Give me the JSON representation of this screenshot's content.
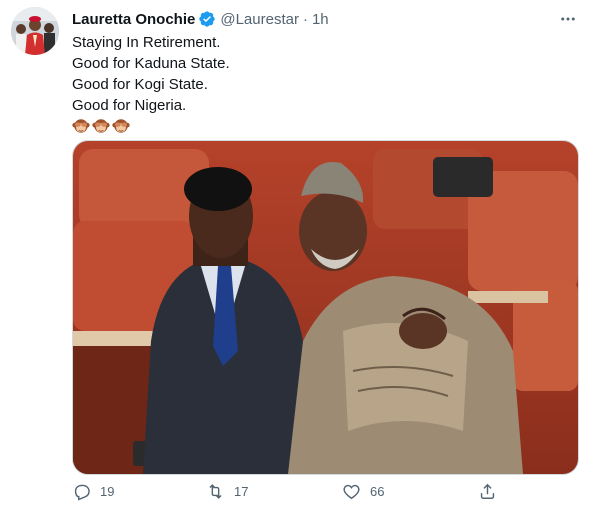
{
  "tweet": {
    "author_name": "Lauretta Onochie",
    "handle": "@Laurestar",
    "separator": "·",
    "time": "1h",
    "lines": [
      "Staying In Retirement.",
      "Good for Kaduna State.",
      "Good for Kogi State.",
      "Good for Nigeria."
    ],
    "emojis": [
      "see-no-evil-monkey",
      "see-no-evil-monkey",
      "see-no-evil-monkey"
    ]
  },
  "actions": {
    "replies": "19",
    "retweets": "17",
    "likes": "66"
  },
  "colors": {
    "verified_badge": "#1d9bf0",
    "secondary_text": "#536471",
    "border": "#cfd9de"
  },
  "icons": {
    "verified": "verified-badge-icon",
    "more": "more-options-icon",
    "reply": "reply-icon",
    "retweet": "retweet-icon",
    "like": "like-icon",
    "share": "share-icon"
  }
}
